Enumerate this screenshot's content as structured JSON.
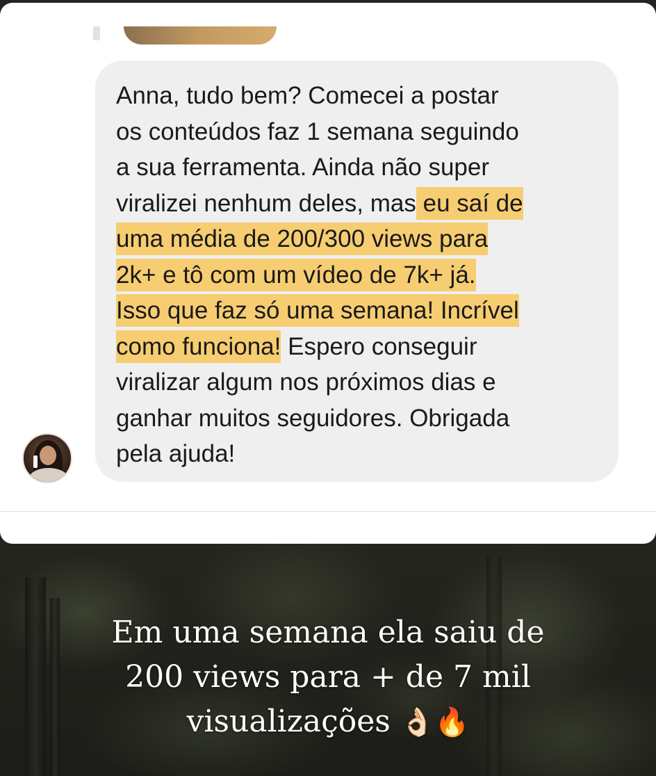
{
  "message": {
    "lines": [
      {
        "pre": "Anna, tudo bem? Comecei a postar",
        "hl": "",
        "post": ""
      },
      {
        "pre": "os conteúdos faz 1 semana seguindo",
        "hl": "",
        "post": ""
      },
      {
        "pre": "a sua ferramenta. Ainda não super",
        "hl": "",
        "post": ""
      },
      {
        "pre": "viralizei nenhum deles, mas",
        "hl": " eu saí de",
        "post": ""
      },
      {
        "pre": "",
        "hl": "uma média de 200/300 views para",
        "post": ""
      },
      {
        "pre": "",
        "hl": "2k+ e tô com um vídeo de 7k+ já.",
        "post": ""
      },
      {
        "pre": "",
        "hl": "Isso que faz só uma semana! Incrível",
        "post": ""
      },
      {
        "pre": "",
        "hl": "como funciona!",
        "post": " Espero conseguir"
      },
      {
        "pre": "viralizar algum nos próximos dias e",
        "hl": "",
        "post": ""
      },
      {
        "pre": "ganhar muitos seguidores. Obrigada",
        "hl": "",
        "post": ""
      },
      {
        "pre": "pela ajuda!",
        "hl": "",
        "post": ""
      }
    ],
    "highlight_color": "#f7cd72",
    "bubble_color": "#efefef"
  },
  "caption": {
    "line1": "Em uma semana ela saiu de",
    "line2": "200 views para + de 7 mil",
    "line3": "visualizações",
    "emoji1": "👌🏻",
    "emoji2": "🔥"
  },
  "icons": {
    "avatar": "user-avatar"
  }
}
